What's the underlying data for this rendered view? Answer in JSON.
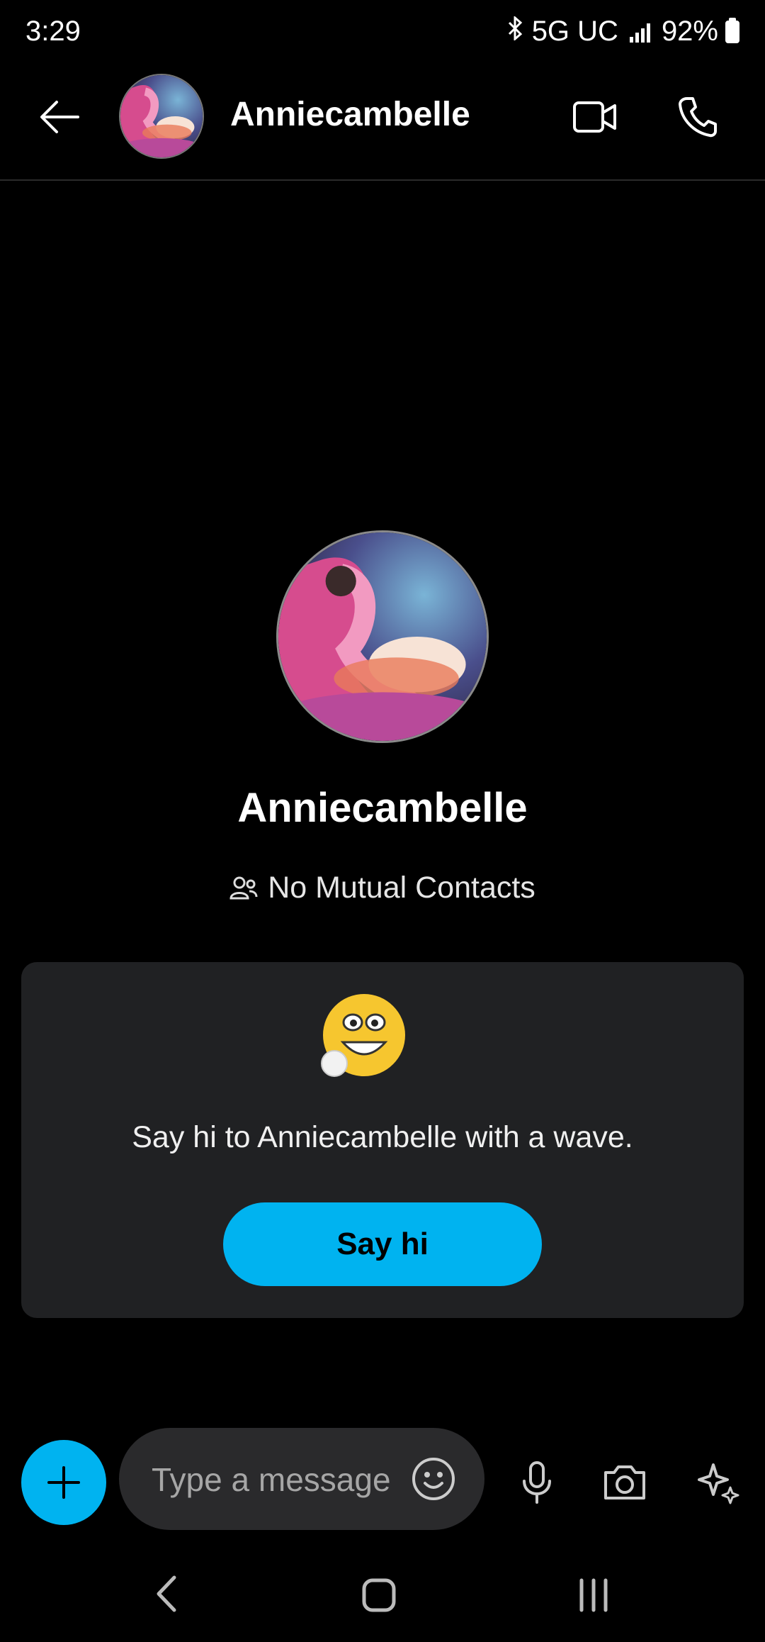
{
  "status_bar": {
    "time": "3:29",
    "network": "5G UC",
    "battery": "92%",
    "icons": [
      "bluetooth-icon",
      "signal-icon",
      "battery-icon"
    ]
  },
  "header": {
    "contact_name": "Anniecambelle",
    "icons": [
      "back-arrow-icon",
      "video-call-icon",
      "phone-call-icon"
    ]
  },
  "profile": {
    "name": "Anniecambelle",
    "mutual_contacts": "No Mutual Contacts"
  },
  "wave_card": {
    "message": "Say hi to Anniecambelle with a wave.",
    "button_label": "Say hi"
  },
  "composer": {
    "placeholder": "Type a message",
    "icons": [
      "plus-icon",
      "emoji-icon",
      "microphone-icon",
      "camera-icon",
      "sparkle-icon"
    ]
  },
  "colors": {
    "accent": "#00b3f0",
    "background": "#000000",
    "card": "#202123",
    "input": "#2a2a2c"
  }
}
